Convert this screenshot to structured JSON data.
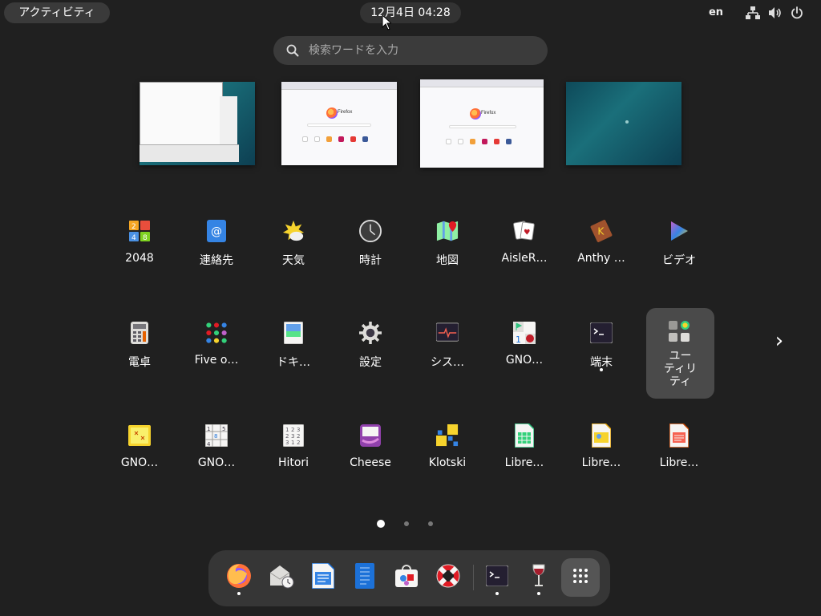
{
  "topbar": {
    "activities_label": "アクティビティ",
    "clock": "12月4日  04:28",
    "input_source": "en",
    "status_icons": [
      "network-icon",
      "volume-icon",
      "power-icon"
    ]
  },
  "search": {
    "placeholder": "検索ワードを入力"
  },
  "workspaces": [
    {
      "name": "workspace-1",
      "content": "terminal-window"
    },
    {
      "name": "workspace-2",
      "content": "firefox-window",
      "window_title": "Firefox"
    },
    {
      "name": "workspace-3",
      "content": "firefox-window",
      "window_title": "Firefox"
    },
    {
      "name": "workspace-4",
      "content": "empty"
    }
  ],
  "apps": [
    {
      "label": "2048",
      "icon": "2048-icon"
    },
    {
      "label": "連絡先",
      "icon": "contacts-icon"
    },
    {
      "label": "天気",
      "icon": "weather-icon"
    },
    {
      "label": "時計",
      "icon": "clock-icon"
    },
    {
      "label": "地図",
      "icon": "maps-icon"
    },
    {
      "label": "AisleR…",
      "icon": "cards-icon"
    },
    {
      "label": "Anthy …",
      "icon": "anthy-icon"
    },
    {
      "label": "ビデオ",
      "icon": "video-icon"
    },
    {
      "label": "電卓",
      "icon": "calculator-icon"
    },
    {
      "label": "Five o…",
      "icon": "five-or-more-icon"
    },
    {
      "label": "ドキ…",
      "icon": "document-viewer-icon"
    },
    {
      "label": "設定",
      "icon": "settings-icon"
    },
    {
      "label": "シス…",
      "icon": "system-monitor-icon"
    },
    {
      "label": "GNO…",
      "icon": "gnome-klotski-icon"
    },
    {
      "label": "端末",
      "icon": "terminal-icon",
      "running": true
    },
    {
      "label": "GNO…",
      "icon": "sticky-notes-icon"
    },
    {
      "label": "GNO…",
      "icon": "sudoku-icon"
    },
    {
      "label": "Hitori",
      "icon": "hitori-icon"
    },
    {
      "label": "Cheese",
      "icon": "cheese-icon"
    },
    {
      "label": "Klotski",
      "icon": "klotski-icon"
    },
    {
      "label": "Libre…",
      "icon": "calc-icon"
    },
    {
      "label": "Libre…",
      "icon": "impress-icon"
    },
    {
      "label": "Libre…",
      "icon": "writer-icon"
    }
  ],
  "folder": {
    "label": "ユー\nティリ\nティ"
  },
  "pager": {
    "pages": 3,
    "current": 1
  },
  "dock": [
    {
      "name": "firefox",
      "icon": "firefox-icon",
      "running": true
    },
    {
      "name": "evolution",
      "icon": "mail-icon"
    },
    {
      "name": "writer",
      "icon": "writer-icon"
    },
    {
      "name": "text-editor",
      "icon": "text-editor-icon"
    },
    {
      "name": "software",
      "icon": "software-icon"
    },
    {
      "name": "help",
      "icon": "help-icon"
    },
    {
      "name": "terminal",
      "icon": "terminal-icon",
      "running": true
    },
    {
      "name": "wine",
      "icon": "wine-icon",
      "running": true
    },
    {
      "name": "show-apps",
      "icon": "app-grid-icon"
    }
  ],
  "colors": {
    "background": "#202020",
    "pill": "#3a3a3a",
    "dock": "#363636",
    "folder": "#4a4a4a"
  }
}
